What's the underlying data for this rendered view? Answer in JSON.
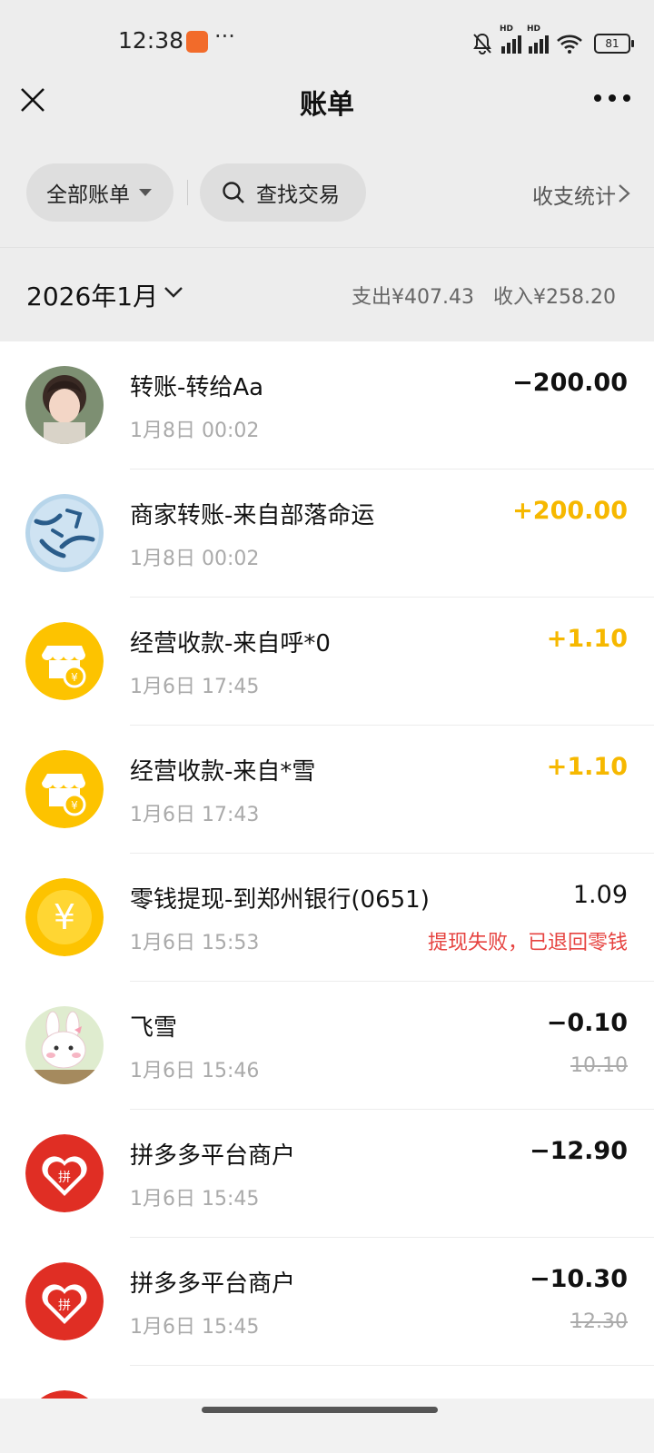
{
  "status_bar": {
    "time": "12:38",
    "dots": "···",
    "battery": "81"
  },
  "nav": {
    "title": "账单"
  },
  "filters": {
    "all_bills": "全部账单",
    "search": "查找交易",
    "stats": "收支统计"
  },
  "month_bar": {
    "month": "2026年1月",
    "expense": "支出¥407.43",
    "income": "收入¥258.20"
  },
  "transactions": [
    {
      "title": "转账-转给Aa",
      "time": "1月8日 00:02",
      "amount": "−200.00",
      "avatar": "anime-girl-avatar"
    },
    {
      "title": "商家转账-来自部落命运",
      "time": "1月8日 00:02",
      "amount": "+200.00",
      "avatar": "game-logo-avatar"
    },
    {
      "title": "经营收款-来自呼*0",
      "time": "1月6日 17:45",
      "amount": "+1.10",
      "avatar": "shop-icon"
    },
    {
      "title": "经营收款-来自*雪",
      "time": "1月6日 17:43",
      "amount": "+1.10",
      "avatar": "shop-icon"
    },
    {
      "title": "零钱提现-到郑州银行(0651)",
      "time": "1月6日 15:53",
      "amount": "1.09",
      "note": "提现失败，已退回零钱",
      "avatar": "yuan-coin-icon"
    },
    {
      "title": "飞雪",
      "time": "1月6日 15:46",
      "amount": "−0.10",
      "original": "10.10",
      "avatar": "cartoon-bunny-avatar"
    },
    {
      "title": "拼多多平台商户",
      "time": "1月6日 15:45",
      "amount": "−12.90",
      "avatar": "pinduoduo-icon"
    },
    {
      "title": "拼多多平台商户",
      "time": "1月6日 15:45",
      "amount": "−10.30",
      "original": "12.30",
      "avatar": "pinduoduo-icon"
    }
  ],
  "colors": {
    "income": "#f6b800",
    "failure": "#e64340",
    "background": "#ededed",
    "card": "#ffffff"
  }
}
